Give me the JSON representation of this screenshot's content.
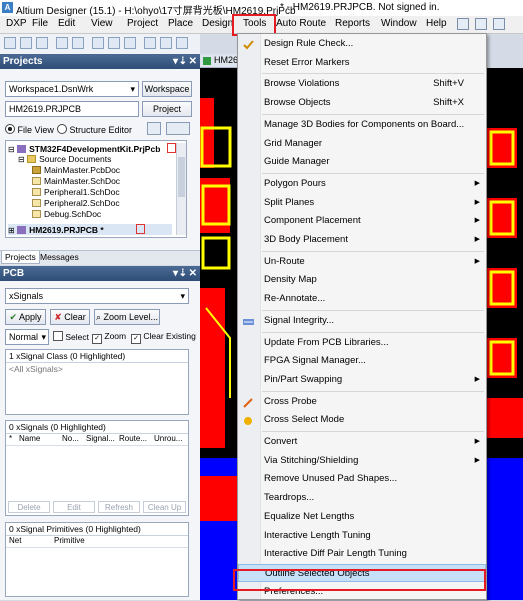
{
  "window": {
    "title": "Altium Designer (15.1) - H:\\ohyo\\17寸屏背光板\\HM2619.PrjPcb",
    "title_tail": "* - HM2619.PRJPCB. Not signed in."
  },
  "menubar": {
    "items": [
      "DXP",
      "File",
      "Edit",
      "View",
      "Project",
      "Place",
      "Design",
      "Tools",
      "Auto Route",
      "Reports",
      "Window",
      "Help"
    ]
  },
  "pcb_tab": {
    "label": "HM26"
  },
  "projects_panel": {
    "title": "Projects",
    "header_icons": [
      "▾",
      "⇣",
      "✕"
    ],
    "workspace_value": "Workspace1.DsnWrk",
    "workspace_button": "Workspace",
    "project_value": "HM2619.PRJPCB",
    "project_button": "Project",
    "view_file": "File View",
    "view_structure": "Structure Editor",
    "tree": [
      {
        "label": "STM32F4DevelopmentKit.PrjPcb",
        "level": 0,
        "bold": true,
        "kind": "project"
      },
      {
        "label": "Source Documents",
        "level": 1,
        "bold": false,
        "kind": "folder"
      },
      {
        "label": "MainMaster.PcbDoc",
        "level": 2,
        "bold": false,
        "kind": "pcb"
      },
      {
        "label": "MainMaster.SchDoc",
        "level": 2,
        "bold": false,
        "kind": "sch"
      },
      {
        "label": "Peripheral1.SchDoc",
        "level": 2,
        "bold": false,
        "kind": "sch"
      },
      {
        "label": "Peripheral2.SchDoc",
        "level": 2,
        "bold": false,
        "kind": "sch"
      },
      {
        "label": "Debug.SchDoc",
        "level": 2,
        "bold": false,
        "kind": "sch"
      },
      {
        "label": "HM2619.PRJPCB *",
        "level": 0,
        "bold": true,
        "kind": "project",
        "selected": true
      }
    ],
    "tabs": [
      "Projects",
      "Messages"
    ]
  },
  "pcb_panel": {
    "title": "PCB",
    "header_icons": [
      "▾",
      "⇣",
      "✕"
    ],
    "filter_value": "xSignals",
    "apply_label": "Apply",
    "clear_label": "Clear",
    "zoom_level_label": "Zoom Level...",
    "mode_value": "Normal",
    "select_label": "Select",
    "zoom_label": "Zoom",
    "clear_existing_label": "Clear Existing",
    "class_header": "1 xSignal Class (0 Highlighted)",
    "class_item": "<All xSignals>",
    "xsignals_header": "0 xSignals (0 Highlighted)",
    "xsignals_columns": [
      "*",
      "Name",
      "No...",
      "Signal...",
      "Route...",
      "Unrou..."
    ],
    "buttons": [
      "Delete",
      "Edit",
      "Refresh",
      "Clean Up"
    ],
    "primitives_header": "0 xSignal Primitives (0 Highlighted)",
    "primitives_columns": [
      "Net",
      "Primitive"
    ]
  },
  "tools_menu": {
    "items": [
      {
        "label": "Design Rule Check...",
        "icon": "drc-icon",
        "shortcut": "",
        "submenu": false
      },
      {
        "label": "Reset Error Markers",
        "icon": "",
        "shortcut": "",
        "submenu": false
      },
      {
        "sep": true
      },
      {
        "label": "Browse Violations",
        "icon": "",
        "shortcut": "Shift+V",
        "submenu": false
      },
      {
        "label": "Browse Objects",
        "icon": "",
        "shortcut": "Shift+X",
        "submenu": false
      },
      {
        "sep": true
      },
      {
        "label": "Manage 3D Bodies for Components on Board...",
        "icon": "",
        "shortcut": "",
        "submenu": false
      },
      {
        "label": "Grid Manager",
        "icon": "",
        "shortcut": "",
        "submenu": false
      },
      {
        "label": "Guide Manager",
        "icon": "",
        "shortcut": "",
        "submenu": false
      },
      {
        "sep": true
      },
      {
        "label": "Polygon Pours",
        "icon": "",
        "shortcut": "",
        "submenu": true
      },
      {
        "label": "Split Planes",
        "icon": "",
        "shortcut": "",
        "submenu": true
      },
      {
        "label": "Component Placement",
        "icon": "",
        "shortcut": "",
        "submenu": true
      },
      {
        "label": "3D Body Placement",
        "icon": "",
        "shortcut": "",
        "submenu": true
      },
      {
        "sep": true
      },
      {
        "label": "Un-Route",
        "icon": "",
        "shortcut": "",
        "submenu": true
      },
      {
        "label": "Density Map",
        "icon": "",
        "shortcut": "",
        "submenu": false
      },
      {
        "label": "Re-Annotate...",
        "icon": "",
        "shortcut": "",
        "submenu": false
      },
      {
        "sep": true
      },
      {
        "label": "Signal Integrity...",
        "icon": "signal-integrity-icon",
        "shortcut": "",
        "submenu": false
      },
      {
        "sep": true
      },
      {
        "label": "Update From PCB Libraries...",
        "icon": "",
        "shortcut": "",
        "submenu": false
      },
      {
        "label": "FPGA Signal Manager...",
        "icon": "",
        "shortcut": "",
        "submenu": false
      },
      {
        "label": "Pin/Part Swapping",
        "icon": "",
        "shortcut": "",
        "submenu": true
      },
      {
        "sep": true
      },
      {
        "label": "Cross Probe",
        "icon": "cross-probe-icon",
        "shortcut": "",
        "submenu": false
      },
      {
        "label": "Cross Select Mode",
        "icon": "cross-select-icon",
        "shortcut": "",
        "submenu": false
      },
      {
        "sep": true
      },
      {
        "label": "Convert",
        "icon": "",
        "shortcut": "",
        "submenu": true
      },
      {
        "label": "Via Stitching/Shielding",
        "icon": "",
        "shortcut": "",
        "submenu": true
      },
      {
        "label": "Remove Unused Pad Shapes...",
        "icon": "",
        "shortcut": "",
        "submenu": false
      },
      {
        "label": "Teardrops...",
        "icon": "",
        "shortcut": "",
        "submenu": false
      },
      {
        "label": "Equalize Net Lengths",
        "icon": "",
        "shortcut": "",
        "submenu": false
      },
      {
        "label": "Interactive Length Tuning",
        "icon": "",
        "shortcut": "",
        "submenu": false
      },
      {
        "label": "Interactive Diff Pair Length Tuning",
        "icon": "",
        "shortcut": "",
        "submenu": false
      },
      {
        "label": "Outline Selected Objects",
        "icon": "",
        "shortcut": "",
        "submenu": false,
        "highlighted": true
      },
      {
        "label": "Preferences...",
        "icon": "",
        "shortcut": "",
        "submenu": false
      }
    ]
  },
  "colors": {
    "highlight_box": "#e51b24",
    "menu_highlight": "#c5e0f7",
    "pcb_background": "#000000",
    "pcb_red": "#ff0000",
    "pcb_yellow": "#ffff00",
    "pcb_blue": "#0000ff"
  }
}
